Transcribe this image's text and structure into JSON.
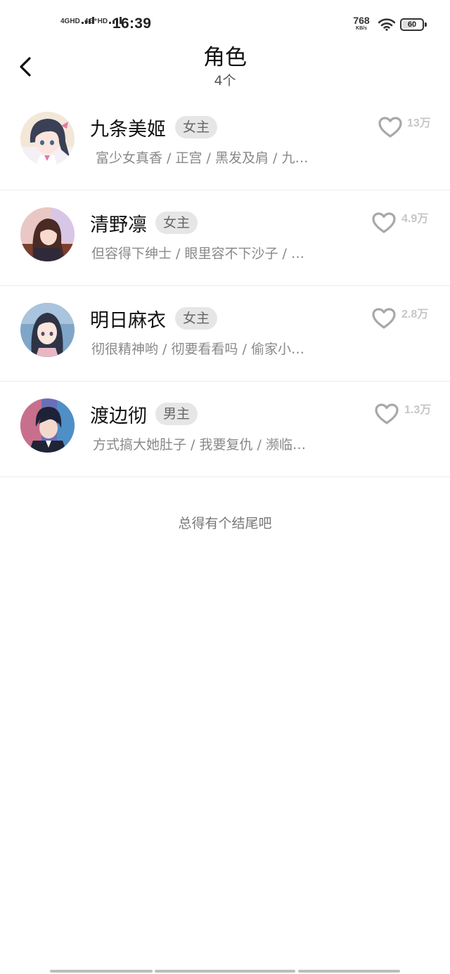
{
  "status_bar": {
    "sim1": "4GHD",
    "sim2": "4G⁺HD",
    "time": "16:39",
    "net_speed": "768",
    "net_speed_unit": "KB/s",
    "battery": "60"
  },
  "header": {
    "title": "角色",
    "subtitle": "4个"
  },
  "characters": [
    {
      "name": "九条美姬",
      "role": "女主",
      "tags": "富少女真香 / 正宫 / 黑发及肩 / 九…",
      "likes": "13万"
    },
    {
      "name": "清野凛",
      "role": "女主",
      "tags": "但容得下绅士 / 眼里容不下沙子 / …",
      "likes": "4.9万"
    },
    {
      "name": "明日麻衣",
      "role": "女主",
      "tags": "彻很精神哟 / 彻要看看吗 / 偷家小…",
      "likes": "2.8万"
    },
    {
      "name": "渡边彻",
      "role": "男主",
      "tags": "方式搞大她肚子 / 我要复仇 / 濒临…",
      "likes": "1.3万"
    }
  ],
  "footer": {
    "end_text": "总得有个结尾吧"
  },
  "icons": {
    "back": "chevron-left-icon",
    "like": "heart-outline-icon",
    "wifi": "wifi-icon",
    "battery": "battery-icon"
  },
  "colors": {
    "badge_bg": "#e6e6e6",
    "like_count": "#c7c7c7",
    "tag_text": "#888888"
  }
}
